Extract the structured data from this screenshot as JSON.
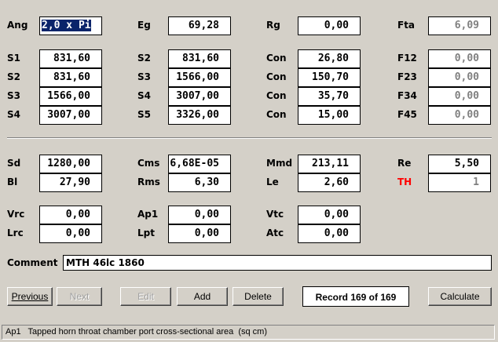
{
  "colors": {
    "background": "#d4d0c8",
    "selection": "#0a246a",
    "th_label": "#ff0000",
    "disabled_text": "#808080"
  },
  "rows": [
    [
      {
        "label": "Ang",
        "value": "2,0 x Pi",
        "selected": true
      },
      {
        "label": "Eg",
        "value": "69,28"
      },
      {
        "label": "Rg",
        "value": "0,00"
      },
      {
        "label": "Fta",
        "value": "6,09",
        "disabled": true
      }
    ],
    [
      {
        "label": "S1",
        "value": "831,60"
      },
      {
        "label": "S2",
        "value": "831,60"
      },
      {
        "label": "Con",
        "value": "26,80"
      },
      {
        "label": "F12",
        "value": "0,00",
        "disabled": true
      }
    ],
    [
      {
        "label": "S2",
        "value": "831,60"
      },
      {
        "label": "S3",
        "value": "1566,00"
      },
      {
        "label": "Con",
        "value": "150,70"
      },
      {
        "label": "F23",
        "value": "0,00",
        "disabled": true
      }
    ],
    [
      {
        "label": "S3",
        "value": "1566,00"
      },
      {
        "label": "S4",
        "value": "3007,00"
      },
      {
        "label": "Con",
        "value": "35,70"
      },
      {
        "label": "F34",
        "value": "0,00",
        "disabled": true
      }
    ],
    [
      {
        "label": "S4",
        "value": "3007,00"
      },
      {
        "label": "S5",
        "value": "3326,00"
      },
      {
        "label": "Con",
        "value": "15,00"
      },
      {
        "label": "F45",
        "value": "0,00",
        "disabled": true
      }
    ],
    [
      {
        "label": "Sd",
        "value": "1280,00"
      },
      {
        "label": "Cms",
        "value": "6,68E-05"
      },
      {
        "label": "Mmd",
        "value": "213,11"
      },
      {
        "label": "Re",
        "value": "5,50"
      }
    ],
    [
      {
        "label": "Bl",
        "value": "27,90"
      },
      {
        "label": "Rms",
        "value": "6,30"
      },
      {
        "label": "Le",
        "value": "2,60"
      },
      {
        "label": "TH",
        "value": "1",
        "disabled": true,
        "red": true
      }
    ],
    [
      {
        "label": "Vrc",
        "value": "0,00"
      },
      {
        "label": "Ap1",
        "value": "0,00"
      },
      {
        "label": "Vtc",
        "value": "0,00"
      }
    ],
    [
      {
        "label": "Lrc",
        "value": "0,00"
      },
      {
        "label": "Lpt",
        "value": "0,00"
      },
      {
        "label": "Atc",
        "value": "0,00"
      }
    ]
  ],
  "comment": {
    "label": "Comment",
    "value": "MTH 46lc 1860"
  },
  "buttons": {
    "previous": "Previous",
    "next": "Next",
    "edit": "Edit",
    "add": "Add",
    "delete": "Delete",
    "calculate": "Calculate"
  },
  "record": "Record 169 of 169",
  "status": "Ap1   Tapped horn throat chamber port cross-sectional area  (sq cm)"
}
